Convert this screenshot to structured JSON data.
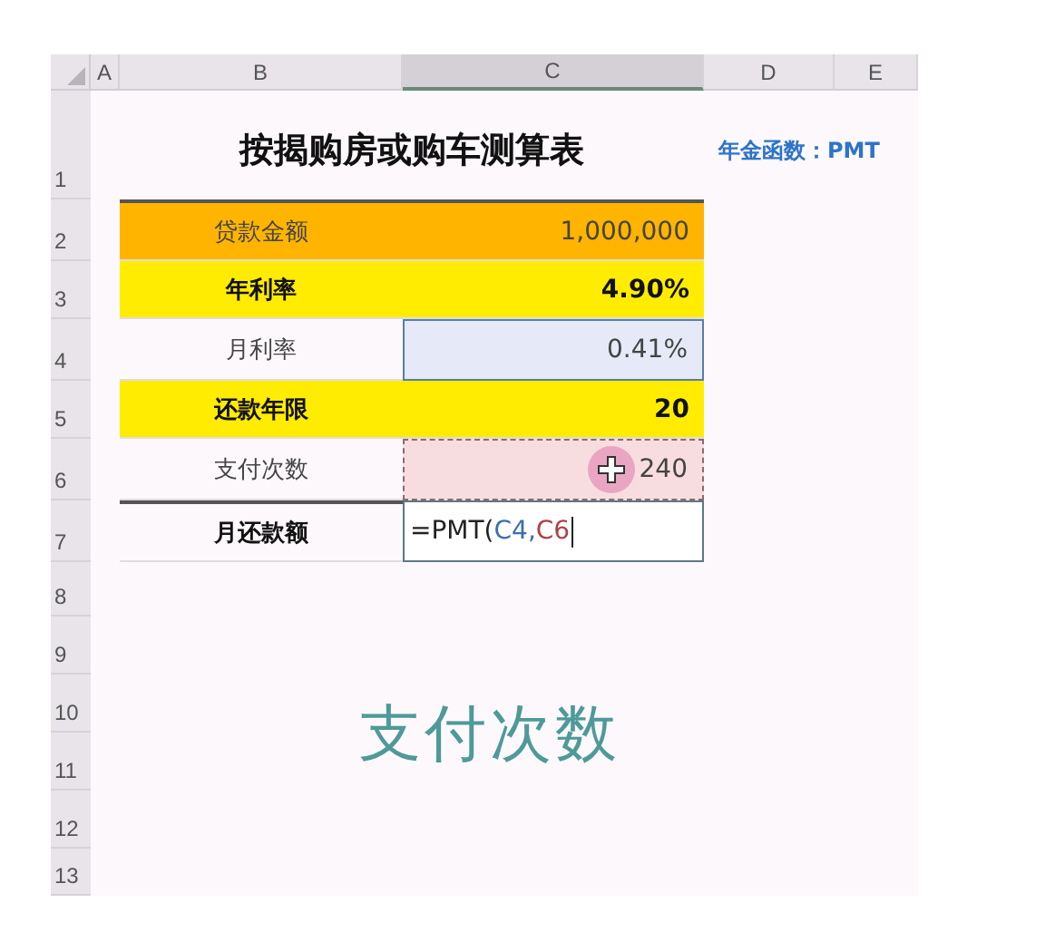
{
  "columns": [
    {
      "label": "A",
      "selected": false
    },
    {
      "label": "B",
      "selected": false
    },
    {
      "label": "C",
      "selected": true
    },
    {
      "label": "D",
      "selected": false
    },
    {
      "label": "E",
      "selected": false
    }
  ],
  "row_numbers": [
    "1",
    "2",
    "3",
    "4",
    "5",
    "6",
    "7",
    "8",
    "9",
    "10",
    "11",
    "12",
    "13"
  ],
  "title": "按揭购房或购车测算表",
  "note": "年金函数：PMT",
  "rows": [
    {
      "label": "贷款金额",
      "value": "1,000,000",
      "kind": "orange",
      "bold": false
    },
    {
      "label": "年利率",
      "value": "4.90%",
      "kind": "yellow",
      "bold": true
    },
    {
      "label": "月利率",
      "value": "0.41%",
      "kind": "selected",
      "bold": false
    },
    {
      "label": "还款年限",
      "value": "20",
      "kind": "yellow",
      "bold": true
    },
    {
      "label": "支付次数",
      "value": "240",
      "kind": "reference",
      "bold": false
    },
    {
      "label": "月还款额",
      "kind": "editing",
      "bold": true,
      "formula": [
        {
          "text": "=PMT(",
          "color": "#222222"
        },
        {
          "text": "C4,",
          "color": "#3a6fb0"
        },
        {
          "text": "C6",
          "color": "#b04048"
        }
      ]
    }
  ],
  "caption": "支付次数"
}
